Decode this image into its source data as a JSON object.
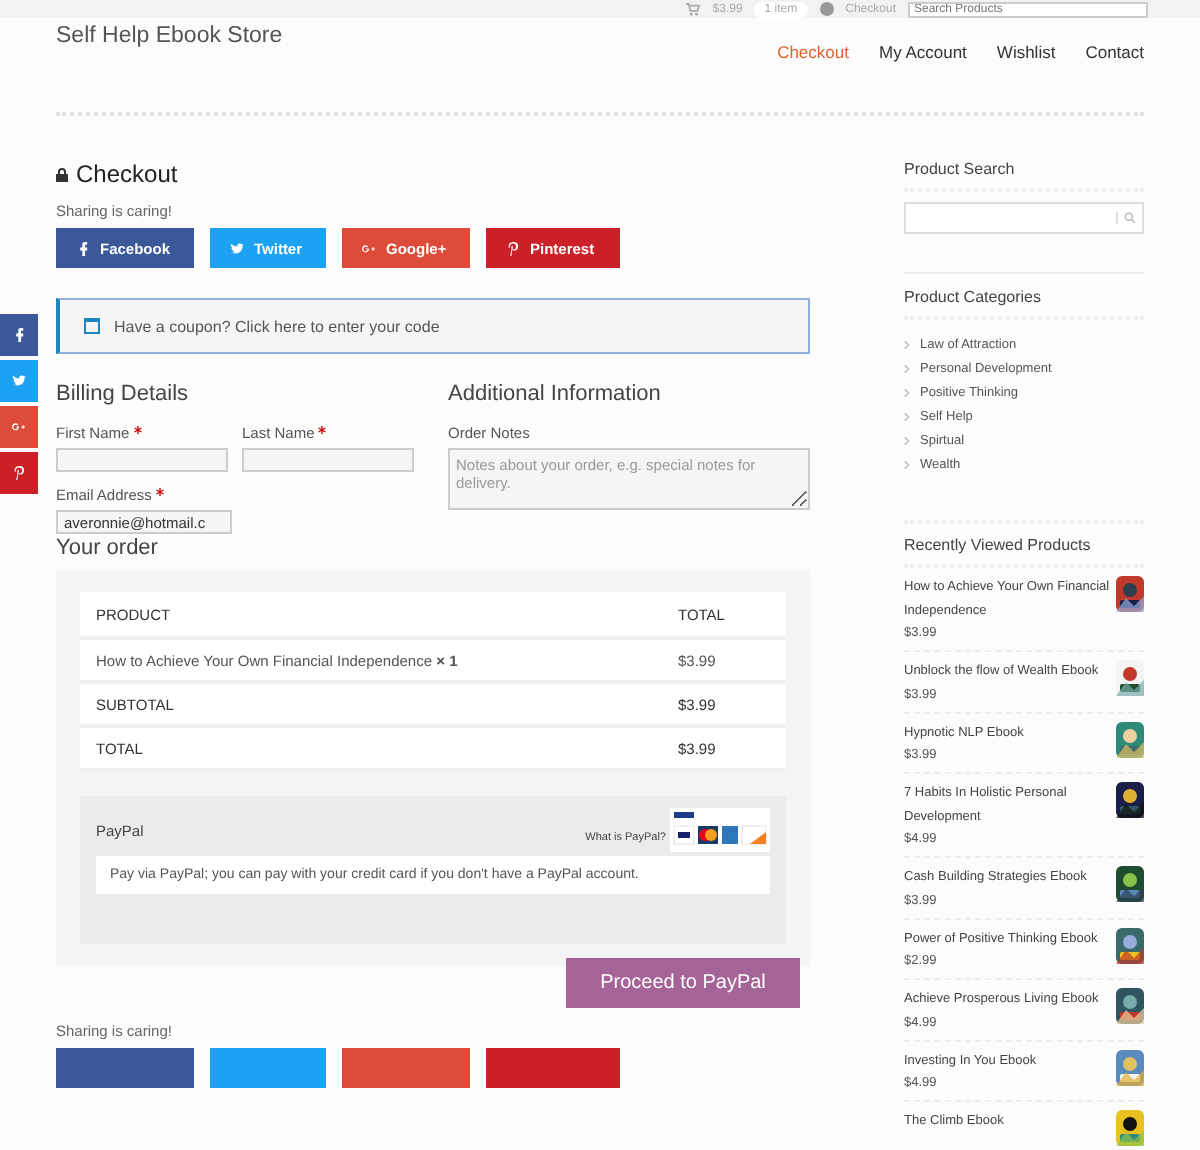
{
  "topbar": {
    "cart_total": "$3.99",
    "cart_count": "1 item",
    "checkout_link": "Checkout",
    "search_placeholder": "Search Products"
  },
  "site_title": "Self Help Ebook Store",
  "nav": [
    {
      "label": "Checkout",
      "selected": true
    },
    {
      "label": "My Account",
      "selected": false
    },
    {
      "label": "Wishlist",
      "selected": false
    },
    {
      "label": "Contact",
      "selected": false
    }
  ],
  "checkout": {
    "title": "Checkout",
    "sharing_label": "Sharing is caring!",
    "share_buttons": [
      {
        "kind": "facebook",
        "label": "Facebook"
      },
      {
        "kind": "twitter",
        "label": "Twitter"
      },
      {
        "kind": "google",
        "label": "Google+"
      },
      {
        "kind": "pinterest",
        "label": "Pinterest"
      }
    ],
    "coupon_text": "Have a coupon? Click here to enter your code",
    "billing": {
      "title": "Billing Details",
      "fields": [
        {
          "label": "First Name",
          "required": true
        },
        {
          "label": "Last Name",
          "required": true
        },
        {
          "label": "Email Address",
          "required": true,
          "value": "averonnie@hotmail.c"
        }
      ]
    },
    "additional": {
      "title": "Additional Information",
      "notes_label": "Order Notes",
      "notes_placeholder": "Notes about your order, e.g. special notes for delivery."
    },
    "order": {
      "title": "Your order",
      "columns": [
        "PRODUCT",
        "TOTAL"
      ],
      "items": [
        {
          "product": "How to Achieve Your Own Financial Independence",
          "qty": "× 1",
          "total": "$3.99"
        }
      ],
      "subtotal_label": "SUBTOTAL",
      "subtotal": "$3.99",
      "total_label": "TOTAL",
      "total": "$3.99"
    },
    "payment": {
      "method": "PayPal",
      "what_is": "What is PayPal?",
      "description": "Pay via PayPal; you can pay with your credit card if you don't have a PayPal account."
    },
    "proceed_button": "Proceed to PayPal",
    "bottom_sharing_label": "Sharing is caring!",
    "bottom_share_buttons": [
      {
        "kind": "facebook"
      },
      {
        "kind": "twitter"
      },
      {
        "kind": "google"
      },
      {
        "kind": "pinterest"
      }
    ]
  },
  "side_share": [
    {
      "kind": "facebook"
    },
    {
      "kind": "twitter"
    },
    {
      "kind": "google"
    },
    {
      "kind": "pinterest"
    }
  ],
  "sidebar": {
    "search_title": "Product Search",
    "categories_title": "Product Categories",
    "categories": [
      "Law of Attraction",
      "Personal Development",
      "Positive Thinking",
      "Self Help",
      "Spirtual",
      "Wealth"
    ],
    "recent_title": "Recently Viewed Products",
    "recent": [
      {
        "title": "How to Achieve Your Own Financial Independence",
        "price": "$3.99"
      },
      {
        "title": "Unblock the flow of Wealth Ebook",
        "price": "$3.99"
      },
      {
        "title": "Hypnotic NLP Ebook",
        "price": "$3.99"
      },
      {
        "title": "7 Habits In Holistic Personal Development",
        "price": "$4.99"
      },
      {
        "title": "Cash Building Strategies Ebook",
        "price": "$3.99"
      },
      {
        "title": "Power of Positive Thinking Ebook",
        "price": "$2.99"
      },
      {
        "title": "Achieve Prosperous Living Ebook",
        "price": "$4.99"
      },
      {
        "title": "Investing In You Ebook",
        "price": "$4.99"
      },
      {
        "title": "The Climb Ebook"
      }
    ]
  }
}
